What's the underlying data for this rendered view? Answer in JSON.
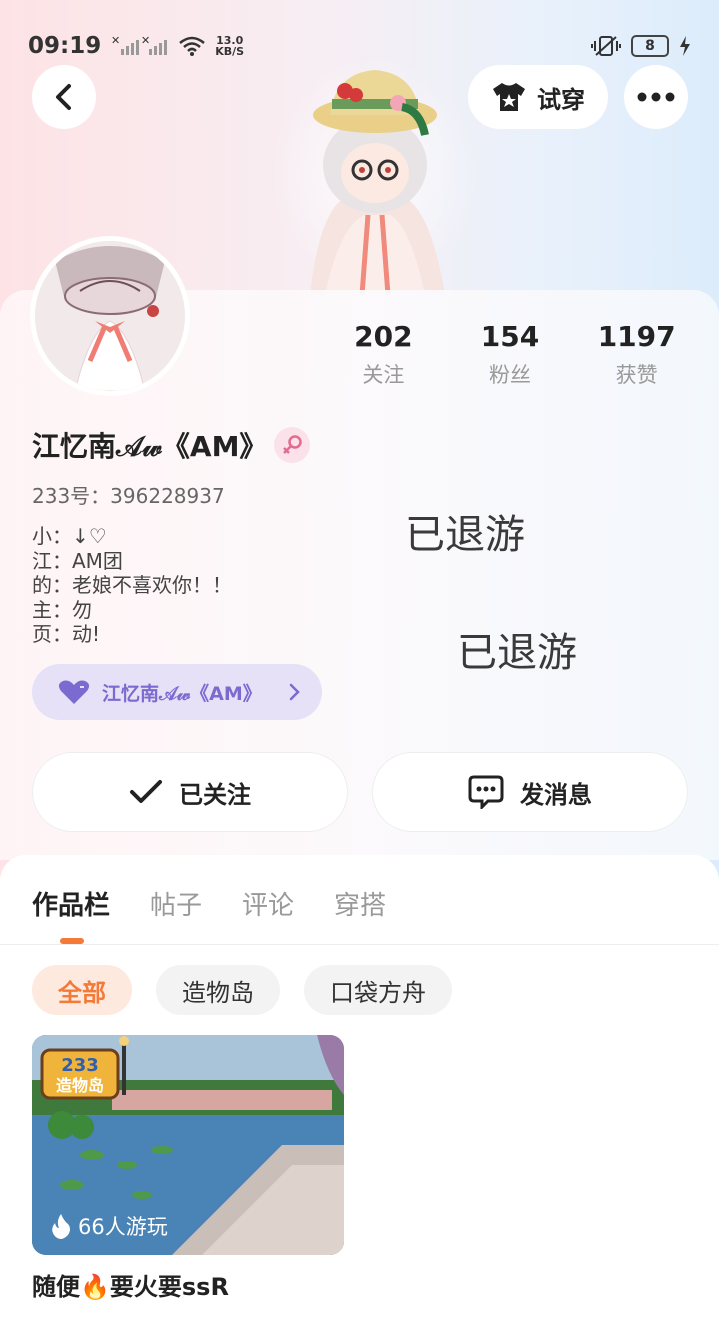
{
  "status_bar": {
    "time": "09:19",
    "net_speed_value": "13.0",
    "net_speed_unit": "KB/S",
    "battery": "8"
  },
  "header": {
    "try_on_label": "试穿"
  },
  "stats": [
    {
      "value": "202",
      "label": "关注"
    },
    {
      "value": "154",
      "label": "粉丝"
    },
    {
      "value": "1197",
      "label": "获赞"
    }
  ],
  "profile": {
    "username": "江忆南𝒜𝓌《AM》",
    "id_text": "233号：396228937",
    "bio_lines": [
      "小：↓♡",
      "江：AM团",
      "的：老娘不喜欢你！！",
      "主：勿",
      "页：动!"
    ],
    "watermark_1": "已退游",
    "watermark_2": "已退游",
    "club_name": "江忆南𝒜𝓌《AM》"
  },
  "actions": {
    "follow_label": "已关注",
    "message_label": "发消息"
  },
  "tabs": [
    "作品栏",
    "帖子",
    "评论",
    "穿搭"
  ],
  "chips": [
    "全部",
    "造物岛",
    "口袋方舟"
  ],
  "game": {
    "logo_number": "233",
    "logo_text": "造物岛",
    "play_count": "66人游玩",
    "title": "随便🔥要火要ssR"
  },
  "colors": {
    "accent": "#f47a3a",
    "club_purple": "#7b6bd0",
    "gender_pink": "#e46a8f"
  }
}
